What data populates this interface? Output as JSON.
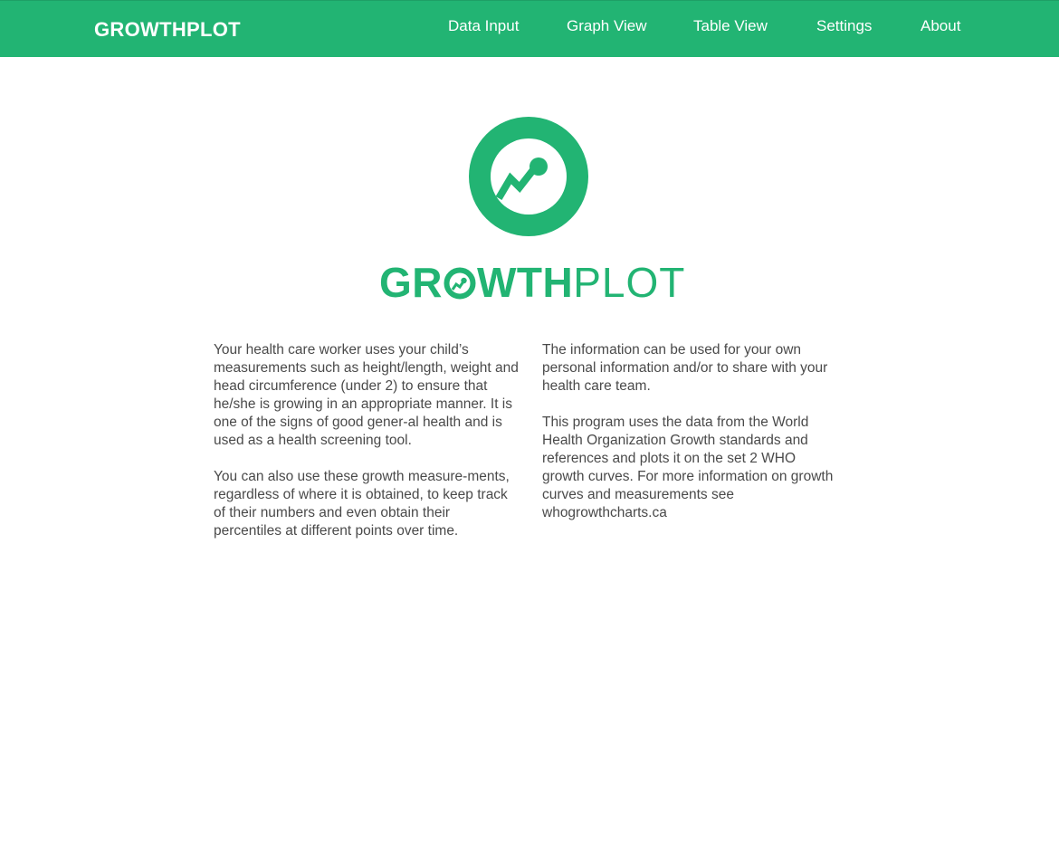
{
  "navbar": {
    "brand": "GROWTHPLOT",
    "items": [
      {
        "label": "Data Input"
      },
      {
        "label": "Graph View"
      },
      {
        "label": "Table View"
      },
      {
        "label": "Settings"
      },
      {
        "label": "About"
      }
    ],
    "background_color": "#22b473"
  },
  "logo": {
    "icon": "growth-chart-circle-icon",
    "wordmark_bold": "GR",
    "wordmark_bold_after_o": "WTH",
    "wordmark_light": "PLOT",
    "color": "#22b473"
  },
  "about": {
    "left_column": [
      "Your health care worker uses your child’s measurements such as height/length, weight and head circumference (under 2) to ensure that he/she is growing in an appropriate manner. It is one of the signs of good gener-al health and is used as a health screening tool.",
      "You can also use these growth measure-ments, regardless of where it is obtained, to keep track of their numbers and even obtain their percentiles at different points over time."
    ],
    "right_column": [
      "The information can be used for your own personal information and/or to share with your health care team.",
      "This program uses the data from the World Health Organization Growth standards and references and plots it on the set 2 WHO growth curves. For more information on growth curves and measurements see whogrowthcharts.ca"
    ]
  }
}
